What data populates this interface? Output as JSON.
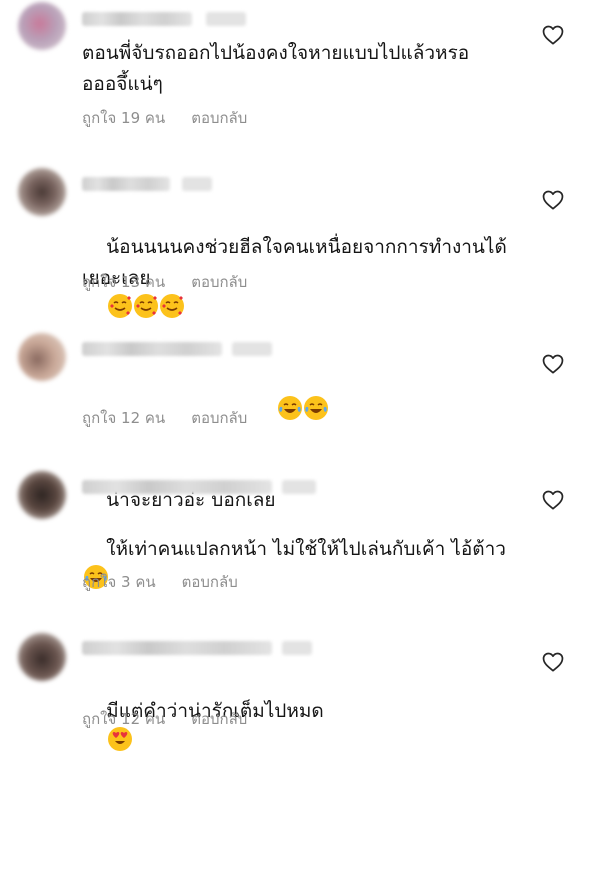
{
  "comments": [
    {
      "text": "ตอนพี่จับรถออกไปน้องคงใจหายแบบไปแล้วหรอ\nอออจึ้แน่ๆ",
      "likes_label": "ถูกใจ 19 คน",
      "reply_label": "ตอบกลับ",
      "emojis": []
    },
    {
      "text": "น้อนนนนคงช่วยฮีลใจคนเหนื่อยจากการทำงานได้\nเยอะเลย",
      "likes_label": "ถูกใจ 13 คน",
      "reply_label": "ตอบกลับ",
      "emojis": [
        "smiling-face-with-hearts-emoji",
        "smiling-face-with-hearts-emoji",
        "smiling-face-with-hearts-emoji"
      ]
    },
    {
      "text": "น่าจะยาวอ่ะ บอกเลย",
      "likes_label": "ถูกใจ 12 คน",
      "reply_label": "ตอบกลับ",
      "emojis": [
        "tears-of-joy-emoji",
        "tears-of-joy-emoji"
      ]
    },
    {
      "text": "ให้เท่าคนแปลกหน้า ไม่ใช้ให้ไปเล่นกับเค้า ไอ้ต้าว\n",
      "likes_label": "ถูกใจ 3 คน",
      "reply_label": "ตอบกลับ",
      "emojis": [
        "tears-of-joy-emoji"
      ]
    },
    {
      "text": "มีแต่คำว่าน่ารักเต็มไปหมด",
      "likes_label": "ถูกใจ 12 คน",
      "reply_label": "ตอบกลับ",
      "emojis": [
        "heart-eyes-emoji"
      ]
    }
  ],
  "colors": {
    "text": "#151515",
    "meta": "#8e8e8e",
    "heart_outline": "#262626",
    "emoji_yellow": "#fcc21b",
    "emoji_heart_red": "#e8323c",
    "tear_blue": "#5fa8e6"
  }
}
